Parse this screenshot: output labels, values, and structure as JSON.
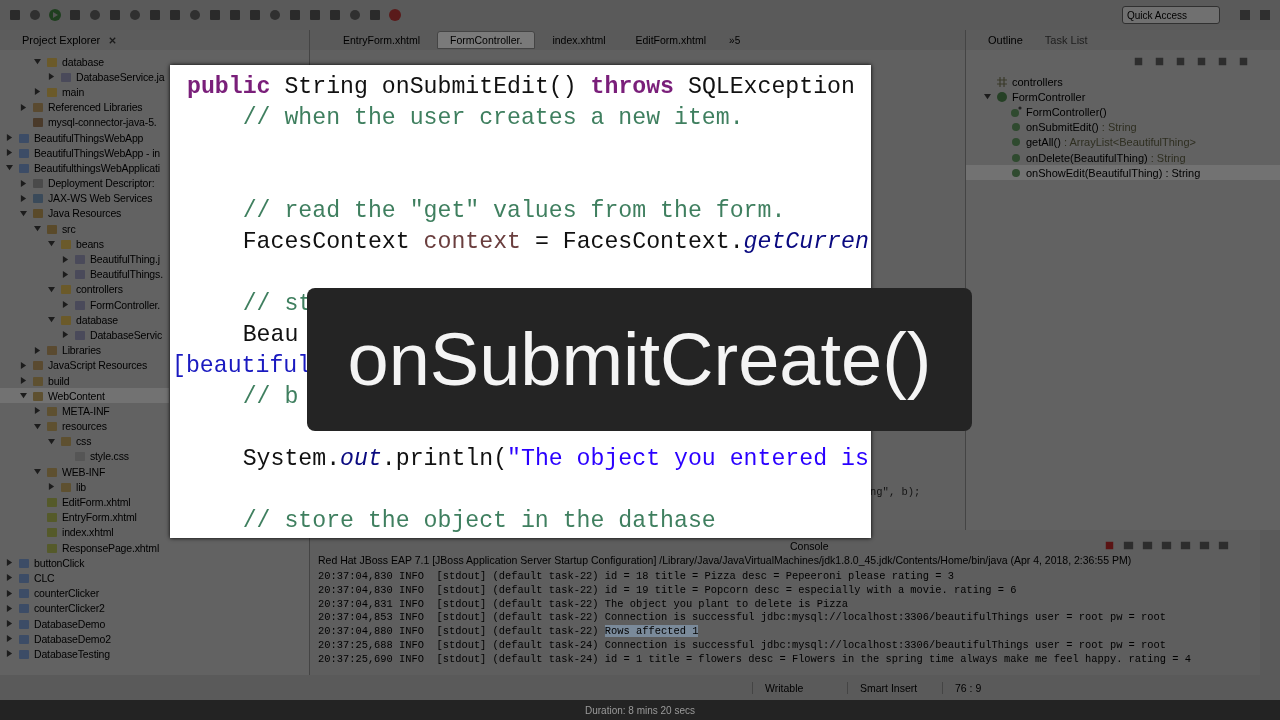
{
  "toolbar": {
    "quick_access": {
      "placeholder": "Quick Access"
    }
  },
  "explorer": {
    "title": "Project Explorer",
    "tree": [
      {
        "children": [
          {
            "children": [
              {
                "label": "database",
                "kind": "package",
                "expanded": true,
                "selected": false,
                "children": [
                  {
                    "label": "DatabaseService.ja",
                    "kind": "java",
                    "expanded": false,
                    "selected": false
                  }
                ]
              },
              {
                "label": "main",
                "kind": "package",
                "expanded": false,
                "selected": false
              }
            ]
          },
          {
            "label": "Referenced Libraries",
            "kind": "library",
            "expanded": false,
            "selected": false
          },
          {
            "label": "mysql-connector-java-5.",
            "kind": "jar",
            "selected": false
          }
        ]
      },
      {
        "label": "BeautifulThingsWebApp",
        "kind": "project",
        "expanded": false,
        "selected": false
      },
      {
        "label": "BeautifulThingsWebApp - in",
        "kind": "project",
        "expanded": false,
        "selected": false
      },
      {
        "label": "BeautifulthingsWebApplicati",
        "kind": "project",
        "expanded": true,
        "selected": false,
        "children": [
          {
            "label": "Deployment Descriptor:",
            "kind": "descriptor",
            "expanded": false,
            "selected": false
          },
          {
            "label": "JAX-WS Web Services",
            "kind": "webservice",
            "expanded": false,
            "selected": false
          },
          {
            "label": "Java Resources",
            "kind": "resources",
            "expanded": true,
            "selected": false,
            "children": [
              {
                "label": "src",
                "kind": "srcfolder",
                "expanded": true,
                "selected": false,
                "children": [
                  {
                    "label": "beans",
                    "kind": "package",
                    "expanded": true,
                    "selected": false,
                    "children": [
                      {
                        "label": "BeautifulThing.j",
                        "kind": "java",
                        "expanded": false,
                        "selected": false
                      },
                      {
                        "label": "BeautifulThings.",
                        "kind": "java",
                        "expanded": false,
                        "selected": false
                      }
                    ]
                  },
                  {
                    "label": "controllers",
                    "kind": "package",
                    "expanded": true,
                    "selected": false,
                    "children": [
                      {
                        "label": "FormController.",
                        "kind": "java",
                        "expanded": false,
                        "selected": false
                      }
                    ]
                  },
                  {
                    "label": "database",
                    "kind": "package",
                    "expanded": true,
                    "selected": false,
                    "children": [
                      {
                        "label": "DatabaseServic",
                        "kind": "java",
                        "expanded": false,
                        "selected": false
                      }
                    ]
                  }
                ]
              },
              {
                "label": "Libraries",
                "kind": "library",
                "expanded": false,
                "selected": false
              }
            ]
          },
          {
            "label": "JavaScript Resources",
            "kind": "library",
            "expanded": false,
            "selected": false
          },
          {
            "label": "build",
            "kind": "folder",
            "expanded": false,
            "selected": false
          },
          {
            "label": "WebContent",
            "kind": "folder",
            "expanded": true,
            "selected": true,
            "children": [
              {
                "label": "META-INF",
                "kind": "folder",
                "expanded": false,
                "selected": false
              },
              {
                "label": "resources",
                "kind": "folder",
                "expanded": true,
                "selected": false,
                "children": [
                  {
                    "label": "css",
                    "kind": "folder",
                    "expanded": true,
                    "selected": false,
                    "children": [
                      {
                        "label": "style.css",
                        "kind": "file",
                        "selected": false
                      }
                    ]
                  }
                ]
              },
              {
                "label": "WEB-INF",
                "kind": "folder",
                "expanded": true,
                "selected": false,
                "children": [
                  {
                    "label": "lib",
                    "kind": "folder",
                    "expanded": false,
                    "selected": false
                  }
                ]
              },
              {
                "label": "EditForm.xhtml",
                "kind": "xhtml",
                "selected": false
              },
              {
                "label": "EntryForm.xhtml",
                "kind": "xhtml",
                "selected": false
              },
              {
                "label": "index.xhtml",
                "kind": "xhtml",
                "selected": false
              },
              {
                "label": "ResponsePage.xhtml",
                "kind": "xhtml",
                "selected": false
              }
            ]
          }
        ]
      },
      {
        "label": "buttonClick",
        "kind": "project",
        "expanded": false,
        "selected": false
      },
      {
        "label": "CLC",
        "kind": "project",
        "expanded": false,
        "selected": false
      },
      {
        "label": "counterClicker",
        "kind": "project",
        "expanded": false,
        "selected": false
      },
      {
        "label": "counterClicker2",
        "kind": "project",
        "expanded": false,
        "selected": false
      },
      {
        "label": "DatabaseDemo",
        "kind": "project",
        "expanded": false,
        "selected": false
      },
      {
        "label": "DatabaseDemo2",
        "kind": "project",
        "expanded": false,
        "selected": false
      },
      {
        "label": "DatabaseTesting",
        "kind": "project",
        "expanded": false,
        "selected": false
      }
    ]
  },
  "editor": {
    "tabs": [
      {
        "label": "EntryForm.xhtml",
        "selected": false
      },
      {
        "label": "FormController.",
        "selected": true
      },
      {
        "label": "index.xhtml",
        "selected": false
      },
      {
        "label": "EditForm.xhtml",
        "selected": false
      }
    ],
    "overflow": "»5",
    "fragment": "ng\", b);"
  },
  "outline": {
    "tabs": [
      {
        "label": "Outline",
        "selected": true
      },
      {
        "label": "Task List",
        "selected": false
      }
    ],
    "items": [
      {
        "name": "controllers",
        "kind": "package",
        "selected": false
      },
      {
        "name": "FormController",
        "kind": "class",
        "expanded": true,
        "selected": false,
        "children": [
          {
            "name": "FormController()",
            "kind": "constructor",
            "selected": false
          },
          {
            "name": "onSubmitEdit()",
            "type": " : String",
            "kind": "method",
            "selected": false
          },
          {
            "name": "getAll()",
            "type": " : ArrayList<BeautifulThing>",
            "kind": "method",
            "selected": false
          },
          {
            "name": "onDelete(BeautifulThing)",
            "type": " : String",
            "kind": "method",
            "selected": false
          },
          {
            "name": "onShowEdit(BeautifulThing)",
            "type": " : String",
            "kind": "method",
            "selected": true
          }
        ]
      }
    ]
  },
  "console": {
    "tab": "Console",
    "header": "Red Hat JBoss EAP 7.1 [JBoss Application Server Startup Configuration] /Library/Java/JavaVirtualMachines/jdk1.8.0_45.jdk/Contents/Home/bin/java (Apr 4, 2018, 2:36:55 PM)",
    "lines": [
      {
        "text": "20:37:04,830 INFO  [stdout] (default task-22) id = 18 title = Pizza desc = Pepeeroni please rating = 3"
      },
      {
        "text": "20:37:04,830 INFO  [stdout] (default task-22) id = 19 title = Popcorn desc = especially with a movie. rating = 6"
      },
      {
        "text": "20:37:04,831 INFO  [stdout] (default task-22) The object you plant to delete is Pizza"
      },
      {
        "text": "20:37:04,853 INFO  [stdout] (default task-22) Connection is successful jdbc:mysql://localhost:3306/beautifulThings user = root pw = root"
      },
      {
        "text": "20:37:04,880 INFO  [stdout] (default task-22) ",
        "highlight": "Rows affected 1"
      },
      {
        "text": "20:37:25,688 INFO  [stdout] (default task-24) Connection is successful jdbc:mysql://localhost:3306/beautifulThings user = root pw = root"
      },
      {
        "text": "20:37:25,690 INFO  [stdout] (default task-24) id = 1 title = flowers desc = Flowers in the spring time always make me feel happy. rating = 4"
      }
    ]
  },
  "status_bar": {
    "mode": "Writable",
    "insert": "Smart Insert",
    "position": "76 : 9"
  },
  "video": {
    "duration": "Duration: 8 mins 20 secs"
  },
  "code_zoom": {
    "lines": [
      {
        "kind": "code",
        "parts": [
          {
            "kind": "keyword",
            "text": "public"
          },
          {
            "kind": "plain",
            "text": " String onSubmitEdit() "
          },
          {
            "kind": "keyword",
            "text": "throws"
          },
          {
            "kind": "plain",
            "text": " SQLException"
          }
        ]
      },
      {
        "kind": "code",
        "parts": [
          {
            "kind": "comment",
            "text": "    // when the user creates a new item."
          }
        ]
      },
      {
        "kind": "blank"
      },
      {
        "kind": "blank"
      },
      {
        "kind": "code",
        "parts": [
          {
            "kind": "comment",
            "text": "    // read the \"get\" values from the form."
          }
        ]
      },
      {
        "kind": "code",
        "parts": [
          {
            "kind": "plain",
            "text": "    FacesContext "
          },
          {
            "kind": "variable",
            "text": "context"
          },
          {
            "kind": "plain",
            "text": " = FacesContext."
          },
          {
            "kind": "static",
            "text": "getCurren"
          }
        ]
      },
      {
        "kind": "blank"
      },
      {
        "kind": "code",
        "parts": [
          {
            "kind": "comment",
            "text": "    // st"
          }
        ]
      },
      {
        "kind": "code",
        "parts": [
          {
            "kind": "plain",
            "text": "    Beau"
          }
        ]
      },
      {
        "kind": "wrapped",
        "parts": [
          {
            "kind": "field",
            "text": "[beautiful"
          }
        ]
      },
      {
        "kind": "code",
        "parts": [
          {
            "kind": "comment",
            "text": "    // b"
          }
        ]
      },
      {
        "kind": "blank"
      },
      {
        "kind": "code",
        "parts": [
          {
            "kind": "plain",
            "text": "    System."
          },
          {
            "kind": "static",
            "text": "out"
          },
          {
            "kind": "plain",
            "text": ".println("
          },
          {
            "kind": "string",
            "text": "\"The object you entered is"
          }
        ]
      },
      {
        "kind": "blank"
      },
      {
        "kind": "code",
        "parts": [
          {
            "kind": "comment",
            "text": "    // store the object in the dathase"
          }
        ]
      }
    ]
  },
  "title_card": {
    "text": "onSubmitCreate()"
  }
}
